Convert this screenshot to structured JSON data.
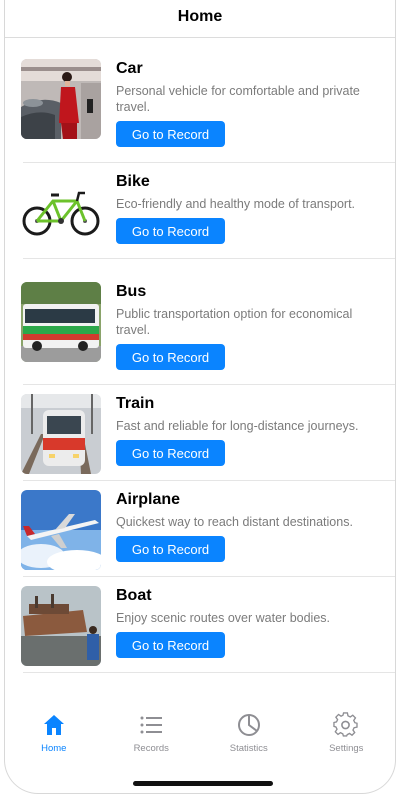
{
  "header": {
    "title": "Home"
  },
  "items": [
    {
      "title": "Car",
      "description": "Personal vehicle for comfortable and private travel.",
      "button": "Go to Record"
    },
    {
      "title": "Bike",
      "description": "Eco-friendly and healthy mode of transport.",
      "button": "Go to Record"
    },
    {
      "title": "Bus",
      "description": "Public transportation option for economical travel.",
      "button": "Go to Record"
    },
    {
      "title": "Train",
      "description": "Fast and reliable for long-distance journeys.",
      "button": "Go to Record"
    },
    {
      "title": "Airplane",
      "description": "Quickest way to reach distant destinations.",
      "button": "Go to Record"
    },
    {
      "title": "Boat",
      "description": "Enjoy scenic routes over water bodies.",
      "button": "Go to Record"
    }
  ],
  "tabbar": {
    "tabs": [
      {
        "label": "Home",
        "icon": "house-icon",
        "active": true
      },
      {
        "label": "Records",
        "icon": "list-icon",
        "active": false
      },
      {
        "label": "Statistics",
        "icon": "pie-chart-icon",
        "active": false
      },
      {
        "label": "Settings",
        "icon": "gear-icon",
        "active": false
      }
    ]
  },
  "colors": {
    "accent": "#0a84ff",
    "inactive": "#8e8e93",
    "description": "#7b7b7b"
  }
}
